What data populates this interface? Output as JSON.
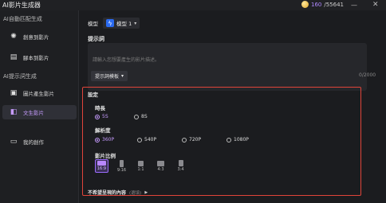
{
  "app": {
    "title": "AI影片生成器",
    "credits_current": "160",
    "credits_total": "/55641",
    "minimize_glyph": "—",
    "close_glyph": "✕"
  },
  "sidebar": {
    "section1": "AI自動匹配生成",
    "section2": "AI提示詞生成",
    "items": [
      {
        "label": "創意到影片",
        "icon": "bulb-icon",
        "glyph": "✺"
      },
      {
        "label": "腳本到影片",
        "icon": "script-icon",
        "glyph": "▤"
      },
      {
        "label": "圖片產生影片",
        "icon": "image-icon",
        "glyph": "▣"
      },
      {
        "label": "文生影片",
        "icon": "text-video-icon",
        "glyph": "◧",
        "active": true
      },
      {
        "label": "我的創作",
        "icon": "folder-icon",
        "glyph": "▭"
      }
    ]
  },
  "model": {
    "label": "模型",
    "icon": "lightning-icon",
    "icon_glyph": "ϟ",
    "value": "模型 1",
    "arrow_glyph": "▾"
  },
  "prompt": {
    "label": "提示詞",
    "placeholder": "請輸入您想要產生的影片描述。",
    "template_button": "提示詞模板",
    "template_arrow": "▾",
    "counter": "0/2000"
  },
  "settings": {
    "title": "設定",
    "duration": {
      "label": "時長",
      "options": [
        "5S",
        "8S"
      ],
      "selected": "5S"
    },
    "resolution": {
      "label": "解析度",
      "options": [
        "360P",
        "540P",
        "720P",
        "1080P"
      ],
      "selected": "360P"
    },
    "aspect": {
      "label": "影片比例",
      "options": [
        "16:9",
        "9:16",
        "1:1",
        "4:3",
        "3:4"
      ],
      "selected": "16:9"
    },
    "negative": {
      "label": "不希望呈現的內容",
      "optional": "(選填)",
      "arrow": "▶"
    }
  },
  "colors": {
    "accent": "#c79cff",
    "highlight_border": "#e0443a",
    "background": "#1b1c1f"
  }
}
